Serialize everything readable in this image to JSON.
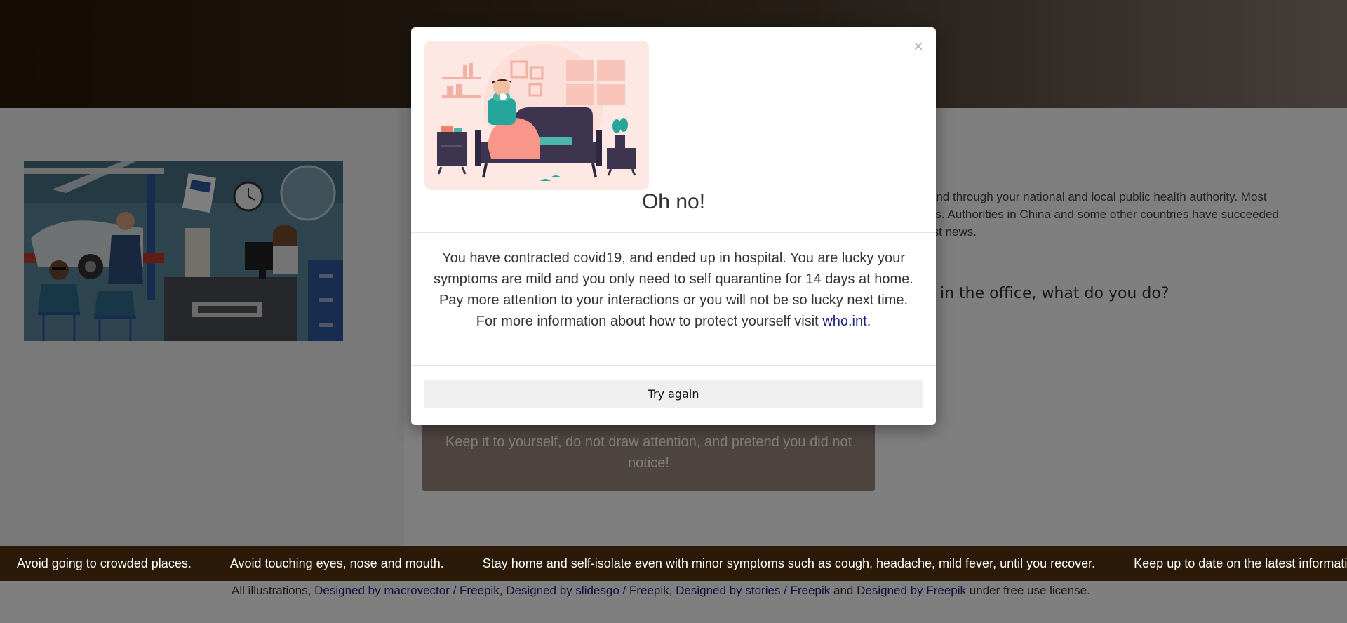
{
  "background": {
    "info_lines": [
      "te and through your national and local public health authority. Most",
      "eaks. Authorities in China and some other countries have succeeded",
      "atest news."
    ],
    "question": "in the office, what do you do?",
    "answer_button": "Keep it to yourself, do not draw attention, and pretend you did not notice!"
  },
  "ticker": {
    "items": [
      "Avoid going to crowded places.",
      "Avoid touching eyes, nose and mouth.",
      "Stay home and self-isolate even with minor symptoms such as cough, headache, mild fever, until you recover.",
      "Keep up to date on the latest information from"
    ]
  },
  "credits": {
    "prefix": "All illustrations,",
    "link1": "Designed by macrovector / Freepik",
    "sep1": ",",
    "link2": "Designed by slidesgo / Freepik",
    "sep2": ",",
    "link3": "Designed by stories / Freepik",
    "and": "and",
    "link4": "Designed by Freepik",
    "suffix": "under free use license."
  },
  "modal": {
    "close": "×",
    "title": "Oh no!",
    "body_text": "You have contracted covid19, and ended up in hospital. You are lucky your symptoms are mild and you only need to self quarantine for 14 days at home. Pay more attention to your interactions or you will not be so lucky next time.",
    "info_prefix": "For more information about how to protect yourself visit",
    "info_link": "who.int",
    "info_suffix": ".",
    "button": "Try again"
  },
  "colors": {
    "header_dark": "#2a1a07",
    "ticker_bg": "#2a1a07",
    "link": "#1a237e",
    "answer_button": "#9e8a80",
    "modal_button": "#efefef"
  }
}
